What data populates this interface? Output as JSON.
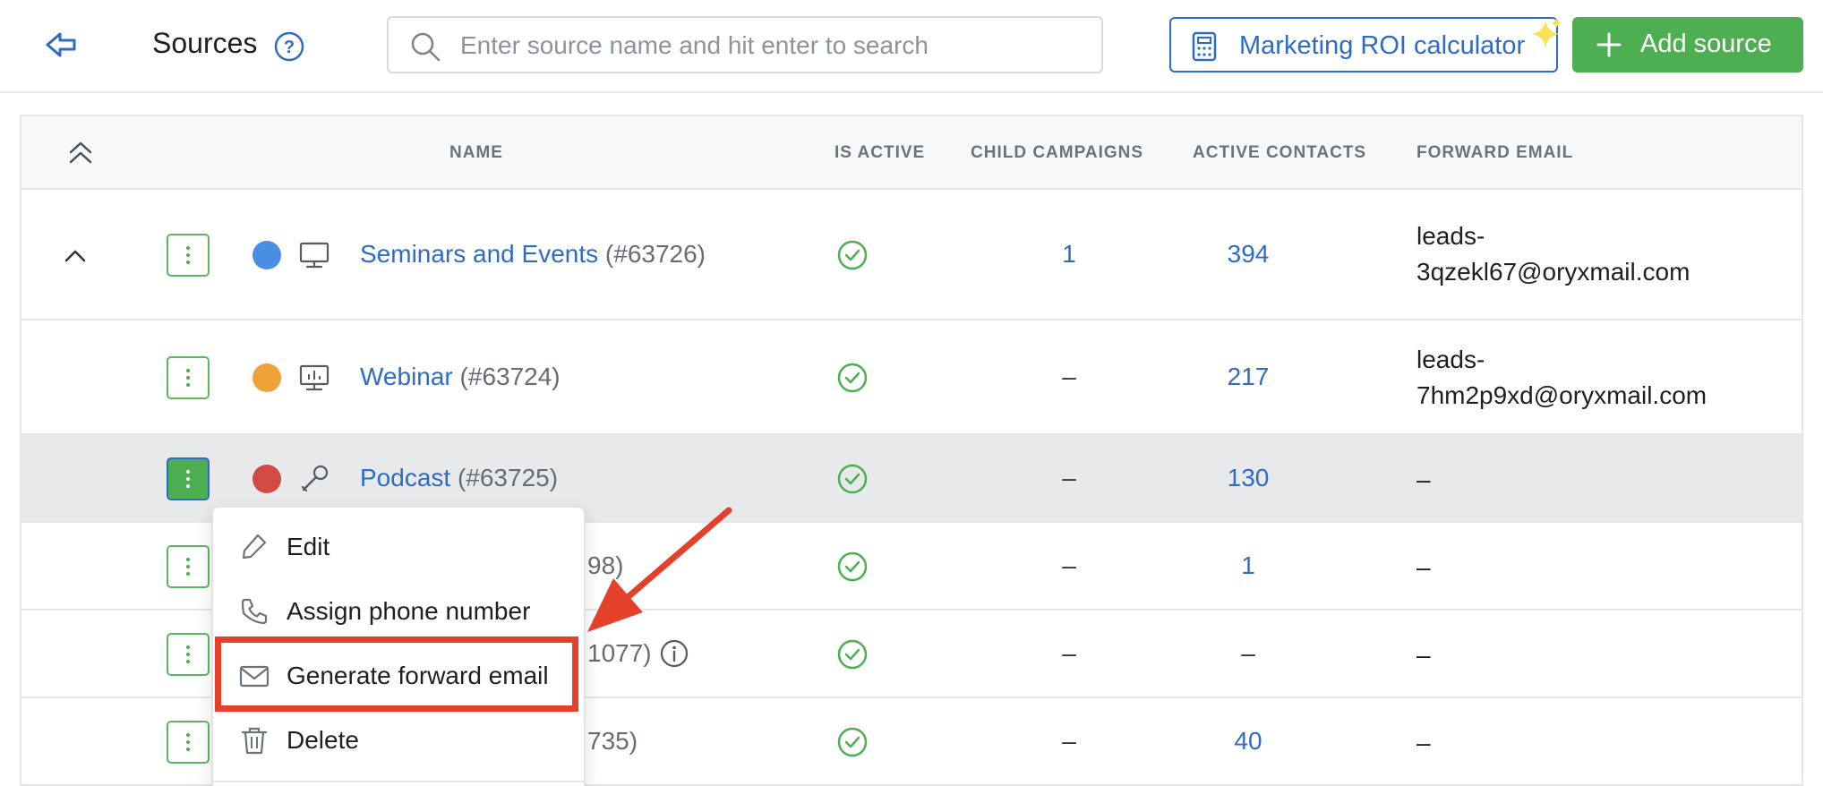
{
  "header": {
    "title": "Sources",
    "search_placeholder": "Enter source name and hit enter to search",
    "search_value": "",
    "roi_button_label": "Marketing ROI calculator",
    "add_button_label": "Add source"
  },
  "table": {
    "columns": {
      "name": "NAME",
      "is_active": "IS ACTIVE",
      "child_campaigns": "CHILD CAMPAIGNS",
      "active_contacts": "ACTIVE CONTACTS",
      "forward_email": "FORWARD EMAIL"
    },
    "rows": [
      {
        "color": "#4a8ee3",
        "icon": "monitor-icon",
        "name": "Seminars and Events",
        "id": "(#63726)",
        "is_active": true,
        "child_campaigns": "1",
        "active_contacts": "394",
        "forward_email_line1": "leads-",
        "forward_email_line2": "3qzekl67@oryxmail.com"
      },
      {
        "color": "#efa23a",
        "icon": "presentation-icon",
        "name": "Webinar",
        "id": "(#63724)",
        "is_active": true,
        "child_campaigns": "–",
        "active_contacts": "217",
        "forward_email_line1": "leads-",
        "forward_email_line2": "7hm2p9xd@oryxmail.com"
      },
      {
        "color": "#d24a41",
        "icon": "microphone-icon",
        "name": "Podcast",
        "id": "(#63725)",
        "is_active": true,
        "child_campaigns": "–",
        "active_contacts": "130",
        "forward_email": "–"
      },
      {
        "partial_name": "98)",
        "is_active": true,
        "child_campaigns": "–",
        "active_contacts": "1",
        "forward_email": "–"
      },
      {
        "partial_name": "1077)",
        "is_active": true,
        "child_campaigns": "–",
        "active_contacts": "–",
        "forward_email": "–"
      },
      {
        "partial_name": "735)",
        "is_active": true,
        "child_campaigns": "–",
        "active_contacts": "40",
        "forward_email": "–"
      }
    ]
  },
  "dropdown": {
    "items": [
      {
        "label": "Edit",
        "icon": "pencil-icon"
      },
      {
        "label": "Assign phone number",
        "icon": "phone-icon"
      },
      {
        "label": "Generate forward email",
        "icon": "mail-icon"
      },
      {
        "label": "Delete",
        "icon": "trash-icon"
      }
    ]
  },
  "colors": {
    "accent_blue": "#2e6bc6",
    "accent_green": "#4dae52",
    "annotation_red": "#e4412b",
    "active_check": "#4dae52"
  }
}
